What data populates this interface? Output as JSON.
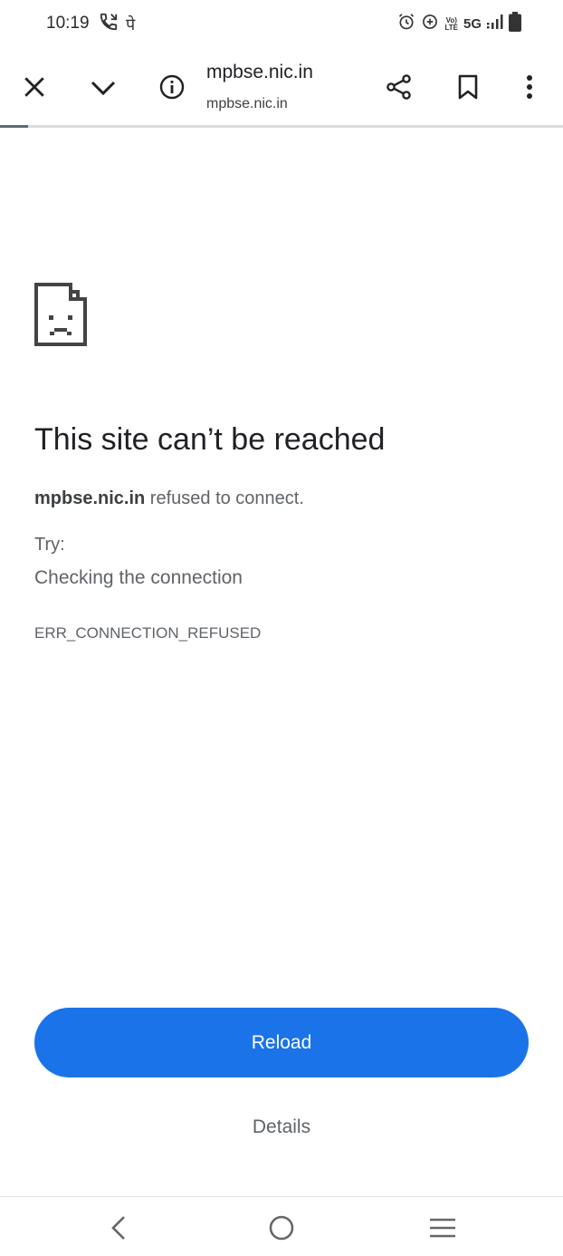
{
  "status_bar": {
    "time": "10:19",
    "extra_glyph": "पे",
    "network": "5G",
    "volte_top": "Vo)",
    "volte_bottom": "LTE",
    "icons": [
      "call-icon",
      "alarm-icon",
      "data-saver-icon",
      "signal-icon",
      "battery-icon"
    ]
  },
  "toolbar": {
    "url_title": "mpbse.nic.in",
    "url_subtitle": "mpbse.nic.in",
    "icons": [
      "close-icon",
      "chevron-down-icon",
      "info-icon",
      "share-icon",
      "bookmark-icon",
      "more-vert-icon"
    ],
    "load_progress": 0.05
  },
  "error": {
    "title": "This site can’t be reached",
    "host": "mpbse.nic.in",
    "message": " refused to connect.",
    "try_label": "Try:",
    "suggestion": "Checking the connection",
    "code": "ERR_CONNECTION_REFUSED"
  },
  "actions": {
    "reload_label": "Reload",
    "details_label": "Details"
  },
  "nav_bar": {
    "icons": [
      "back-icon",
      "home-icon",
      "recents-icon"
    ]
  },
  "colors": {
    "accent": "#1a73e8",
    "text": "#202124",
    "secondary_text": "#5f6368"
  }
}
